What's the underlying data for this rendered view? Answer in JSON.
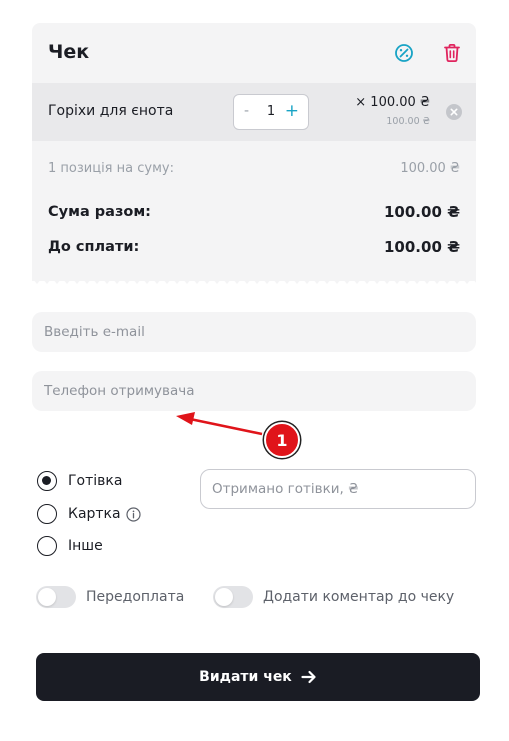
{
  "receipt": {
    "title": "Чек",
    "item": {
      "name": "Горіхи для єнота",
      "quantity": "1",
      "minus": "-",
      "plus": "+",
      "price": "× 100.00 ₴",
      "subtotal": "100.00 ₴"
    },
    "summary": {
      "count_label": "1 позиція на суму:",
      "count_value": "100.00 ₴",
      "total_label": "Сума разом:",
      "total_value": "100.00 ₴",
      "pay_label": "До сплати:",
      "pay_value": "100.00 ₴"
    }
  },
  "form": {
    "email_placeholder": "Введіть e-mail",
    "phone_placeholder": "Телефон отримувача",
    "cash_placeholder": "Отримано готівки, ₴"
  },
  "payment_methods": [
    {
      "label": "Готівка",
      "checked": true
    },
    {
      "label": "Картка",
      "checked": false
    },
    {
      "label": "Інше",
      "checked": false
    }
  ],
  "toggles": {
    "prepay_label": "Передоплата",
    "comment_label": "Додати коментар до чеку"
  },
  "submit_label": "Видати чек",
  "callout": {
    "number": "1"
  },
  "icons": {
    "discount": "percent-circle-icon",
    "delete": "trash-icon",
    "remove": "close-circle-icon",
    "info": "info-icon",
    "arrow": "arrow-right-icon"
  },
  "colors": {
    "accent": "#18a3c5",
    "danger": "#e0245e",
    "primary_button": "#1a1c24",
    "callout": "#e0141a"
  }
}
